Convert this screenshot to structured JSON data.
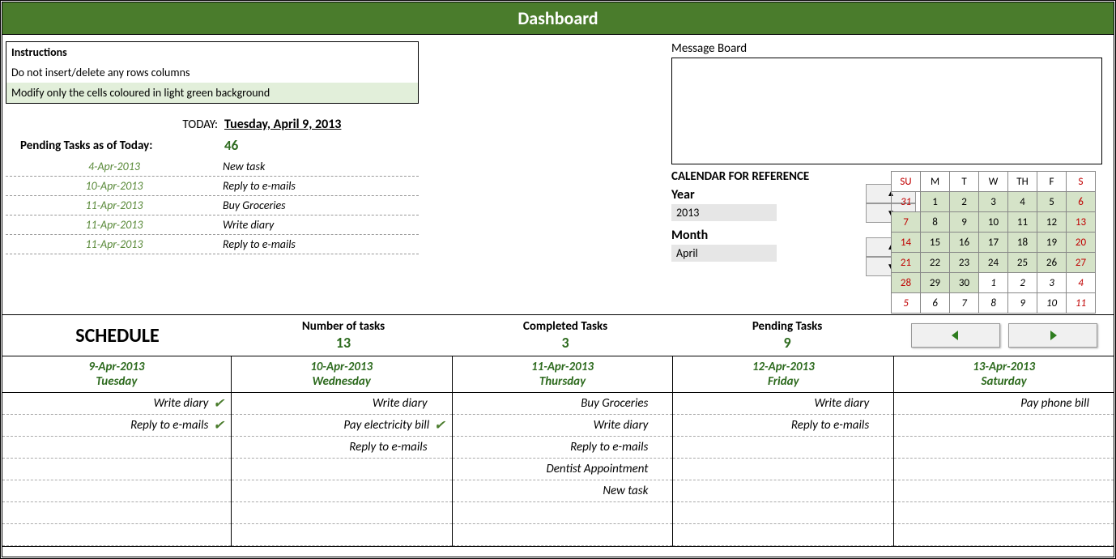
{
  "title": "Dashboard",
  "instructions": {
    "header": "Instructions",
    "line1": "Do not insert/delete any rows columns",
    "line2": "Modify only the cells coloured in light green background"
  },
  "today": {
    "label": "TODAY:",
    "value": "Tuesday, April 9, 2013"
  },
  "pending_summary": {
    "label": "Pending Tasks as of Today:",
    "count": "46"
  },
  "pending_tasks": [
    {
      "date": "4-Apr-2013",
      "desc": "New task"
    },
    {
      "date": "10-Apr-2013",
      "desc": "Reply to e-mails"
    },
    {
      "date": "11-Apr-2013",
      "desc": "Buy Groceries"
    },
    {
      "date": "11-Apr-2013",
      "desc": "Write diary"
    },
    {
      "date": "11-Apr-2013",
      "desc": "Reply to e-mails"
    }
  ],
  "message_board": {
    "label": "Message Board"
  },
  "calendar_ref": {
    "title": "CALENDAR FOR REFERENCE",
    "year_label": "Year",
    "year_value": "2013",
    "month_label": "Month",
    "month_value": "April",
    "days_header": [
      "SU",
      "M",
      "T",
      "W",
      "TH",
      "F",
      "S"
    ],
    "weeks": [
      [
        {
          "d": "31",
          "o": true
        },
        {
          "d": "1"
        },
        {
          "d": "2"
        },
        {
          "d": "3"
        },
        {
          "d": "4"
        },
        {
          "d": "5"
        },
        {
          "d": "6"
        }
      ],
      [
        {
          "d": "7"
        },
        {
          "d": "8"
        },
        {
          "d": "9"
        },
        {
          "d": "10"
        },
        {
          "d": "11"
        },
        {
          "d": "12"
        },
        {
          "d": "13"
        }
      ],
      [
        {
          "d": "14"
        },
        {
          "d": "15"
        },
        {
          "d": "16"
        },
        {
          "d": "17"
        },
        {
          "d": "18"
        },
        {
          "d": "19"
        },
        {
          "d": "20"
        }
      ],
      [
        {
          "d": "21"
        },
        {
          "d": "22"
        },
        {
          "d": "23"
        },
        {
          "d": "24"
        },
        {
          "d": "25"
        },
        {
          "d": "26"
        },
        {
          "d": "27"
        }
      ],
      [
        {
          "d": "28"
        },
        {
          "d": "29"
        },
        {
          "d": "30"
        },
        {
          "d": "1",
          "o": true
        },
        {
          "d": "2",
          "o": true
        },
        {
          "d": "3",
          "o": true
        },
        {
          "d": "4",
          "o": true
        }
      ],
      [
        {
          "d": "5",
          "o": true
        },
        {
          "d": "6",
          "o": true
        },
        {
          "d": "7",
          "o": true
        },
        {
          "d": "8",
          "o": true
        },
        {
          "d": "9",
          "o": true
        },
        {
          "d": "10",
          "o": true
        },
        {
          "d": "11",
          "o": true
        }
      ]
    ]
  },
  "stats": {
    "schedule_title": "SCHEDULE",
    "num_tasks_label": "Number of tasks",
    "num_tasks": "13",
    "completed_label": "Completed Tasks",
    "completed": "3",
    "pending_label": "Pending Tasks",
    "pending": "9"
  },
  "schedule": [
    {
      "date": "9-Apr-2013",
      "day": "Tuesday",
      "items": [
        {
          "t": "Write diary",
          "c": true
        },
        {
          "t": "Reply to e-mails",
          "c": true
        },
        {
          "t": ""
        },
        {
          "t": ""
        },
        {
          "t": ""
        },
        {
          "t": ""
        },
        {
          "t": ""
        }
      ]
    },
    {
      "date": "10-Apr-2013",
      "day": "Wednesday",
      "items": [
        {
          "t": "Write diary"
        },
        {
          "t": "Pay electricity bill",
          "c": true
        },
        {
          "t": "Reply to e-mails"
        },
        {
          "t": ""
        },
        {
          "t": ""
        },
        {
          "t": ""
        },
        {
          "t": ""
        }
      ]
    },
    {
      "date": "11-Apr-2013",
      "day": "Thursday",
      "items": [
        {
          "t": "Buy Groceries"
        },
        {
          "t": "Write diary"
        },
        {
          "t": "Reply to e-mails"
        },
        {
          "t": "Dentist Appointment"
        },
        {
          "t": "New task"
        },
        {
          "t": ""
        },
        {
          "t": ""
        }
      ]
    },
    {
      "date": "12-Apr-2013",
      "day": "Friday",
      "items": [
        {
          "t": "Write diary"
        },
        {
          "t": "Reply to e-mails"
        },
        {
          "t": ""
        },
        {
          "t": ""
        },
        {
          "t": ""
        },
        {
          "t": ""
        },
        {
          "t": ""
        }
      ]
    },
    {
      "date": "13-Apr-2013",
      "day": "Saturday",
      "items": [
        {
          "t": "Pay phone bill"
        },
        {
          "t": ""
        },
        {
          "t": ""
        },
        {
          "t": ""
        },
        {
          "t": ""
        },
        {
          "t": ""
        },
        {
          "t": ""
        }
      ]
    }
  ]
}
